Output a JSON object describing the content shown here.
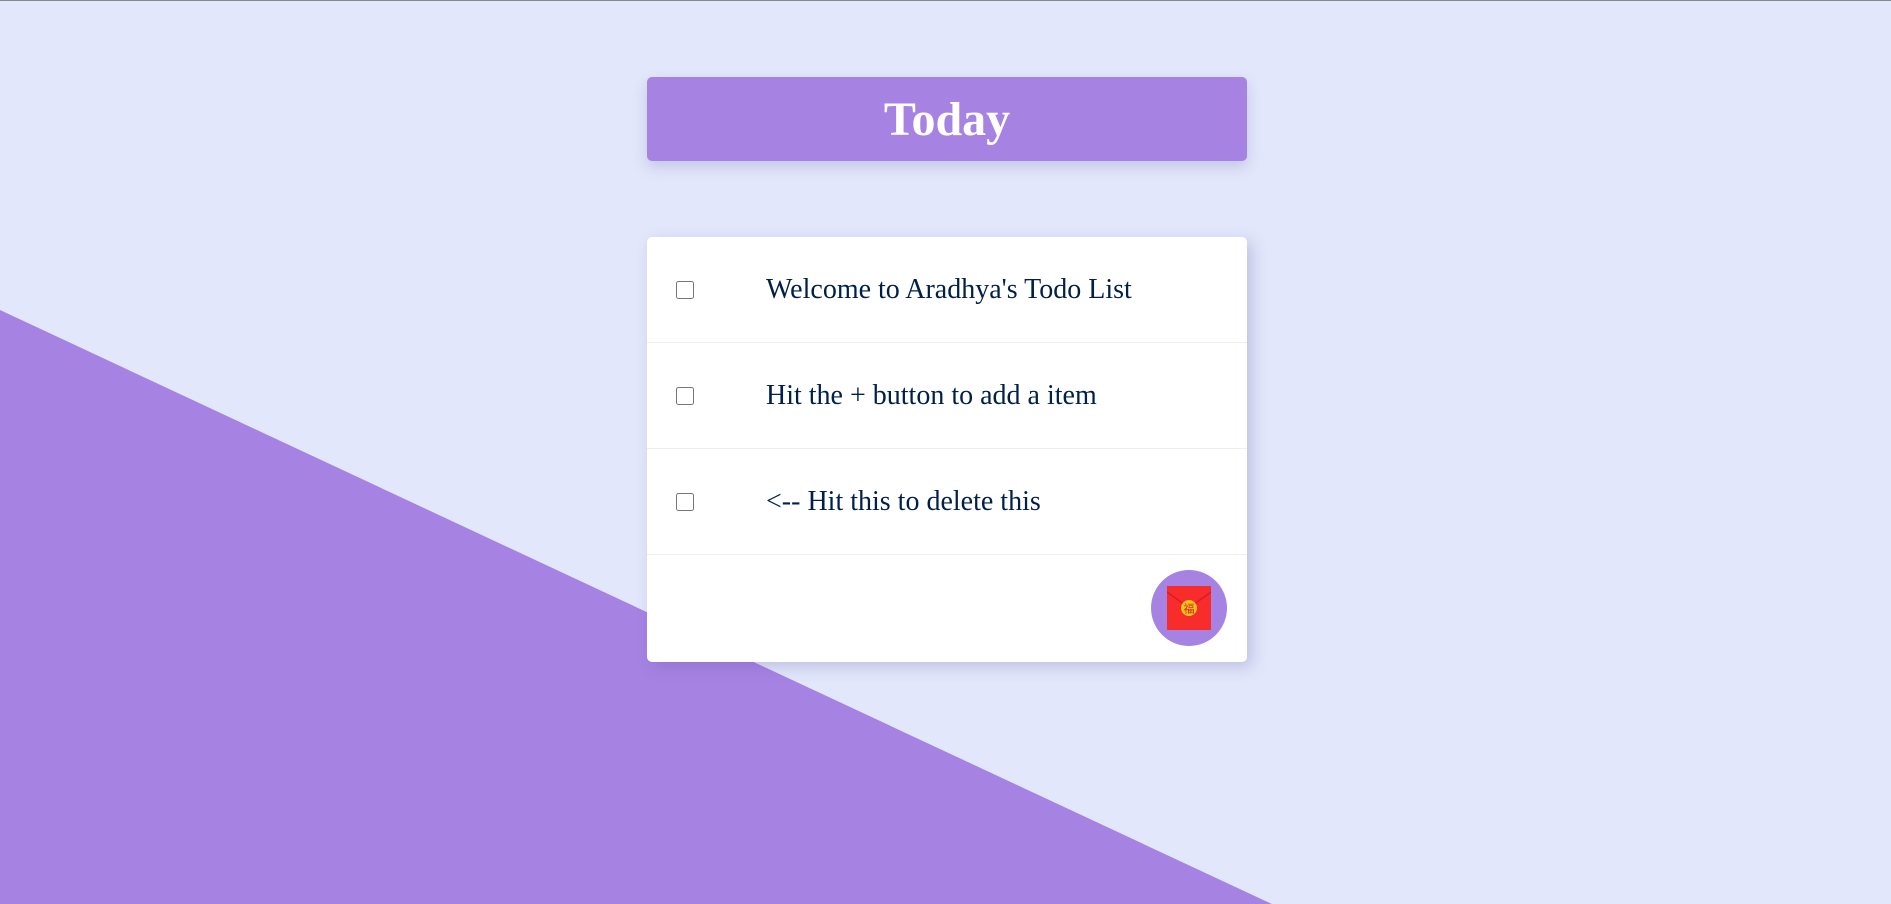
{
  "header": {
    "title": "Today"
  },
  "todo": {
    "items": [
      {
        "text": "Welcome to Aradhya's Todo List",
        "checked": false
      },
      {
        "text": "Hit the + button to add a item",
        "checked": false
      },
      {
        "text": "<-- Hit this to delete this",
        "checked": false
      }
    ],
    "add_button": {
      "icon": "red-envelope-icon",
      "glyph": "福"
    }
  },
  "colors": {
    "background": "#e2e7fb",
    "accent": "#a683e3",
    "card": "#ffffff",
    "text": "#00204a",
    "envelope": "#f92c2c",
    "envelope_seal": "#f5c518"
  }
}
